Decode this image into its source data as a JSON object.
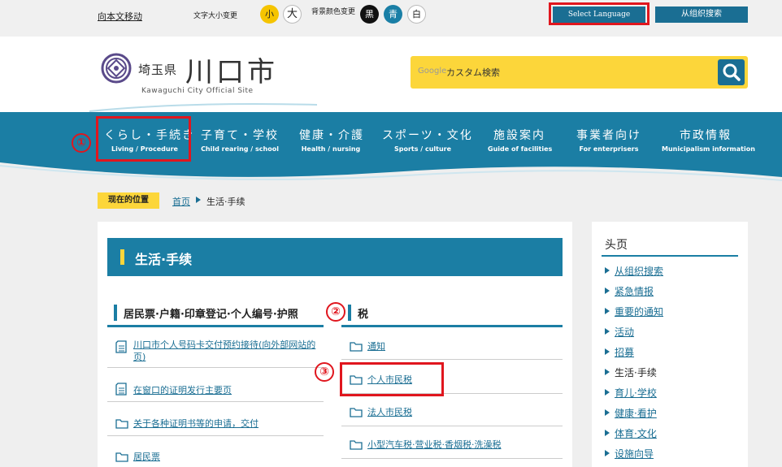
{
  "topbar": {
    "skip_link": "向本文移动",
    "font_size_label": "文字大小变更",
    "font_small": "小",
    "font_large": "大",
    "bg_color_label": "背景颜色变更",
    "bg_black": "黑",
    "bg_blue": "青",
    "bg_white": "白",
    "language_button": "Select Language",
    "org_search_button": "从组织搜索"
  },
  "header": {
    "logo_prefecture": "埼玉県",
    "logo_city": "川口市",
    "logo_english": "Kawaguchi City Official Site",
    "search_google_mark": "Google",
    "search_placeholder": "カスタム検索"
  },
  "nav": {
    "items": [
      {
        "jp": "くらし・手続き",
        "en": "Living / Procedure"
      },
      {
        "jp": "子育て・学校",
        "en": "Child rearing / school"
      },
      {
        "jp": "健康・介護",
        "en": "Health / nursing"
      },
      {
        "jp": "スポーツ・文化",
        "en": "Sports / culture"
      },
      {
        "jp": "施設案内",
        "en": "Guide of facilities"
      },
      {
        "jp": "事業者向け",
        "en": "For enterprisers"
      },
      {
        "jp": "市政情報",
        "en": "Municipalism  information"
      }
    ]
  },
  "markers": {
    "m1": "①",
    "m2": "②",
    "m3": "③"
  },
  "breadcrumb": {
    "tag": "现在的位置",
    "home": "首页",
    "current": "生活·手续"
  },
  "main": {
    "title": "生活·手续",
    "col1": {
      "heading": "居民票·户籍·印章登记·个人编号·护照",
      "items": [
        "川口市个人号码卡交付预约接待(向外部网站的页)",
        "在窗口的证明发行主要页",
        "关于各种证明书等的申请，交付",
        "居民票"
      ]
    },
    "col2": {
      "heading": "税",
      "items": [
        "通知",
        "个人市民税",
        "法人市民税",
        "小型汽车税·营业税·香烟税·洗澡税"
      ]
    }
  },
  "side": {
    "title": "头页",
    "items": [
      "从组织搜索",
      "紧急情报",
      "重要的通知",
      "活动",
      "招募",
      "生活·手续",
      "育儿·学校",
      "健康·看护",
      "体育·文化",
      "设施向导"
    ]
  },
  "colors": {
    "brand_blue": "#1b7ea4",
    "accent_yellow": "#fcd63a",
    "highlight_red": "#e0161e",
    "link_blue": "#1a6e93"
  }
}
